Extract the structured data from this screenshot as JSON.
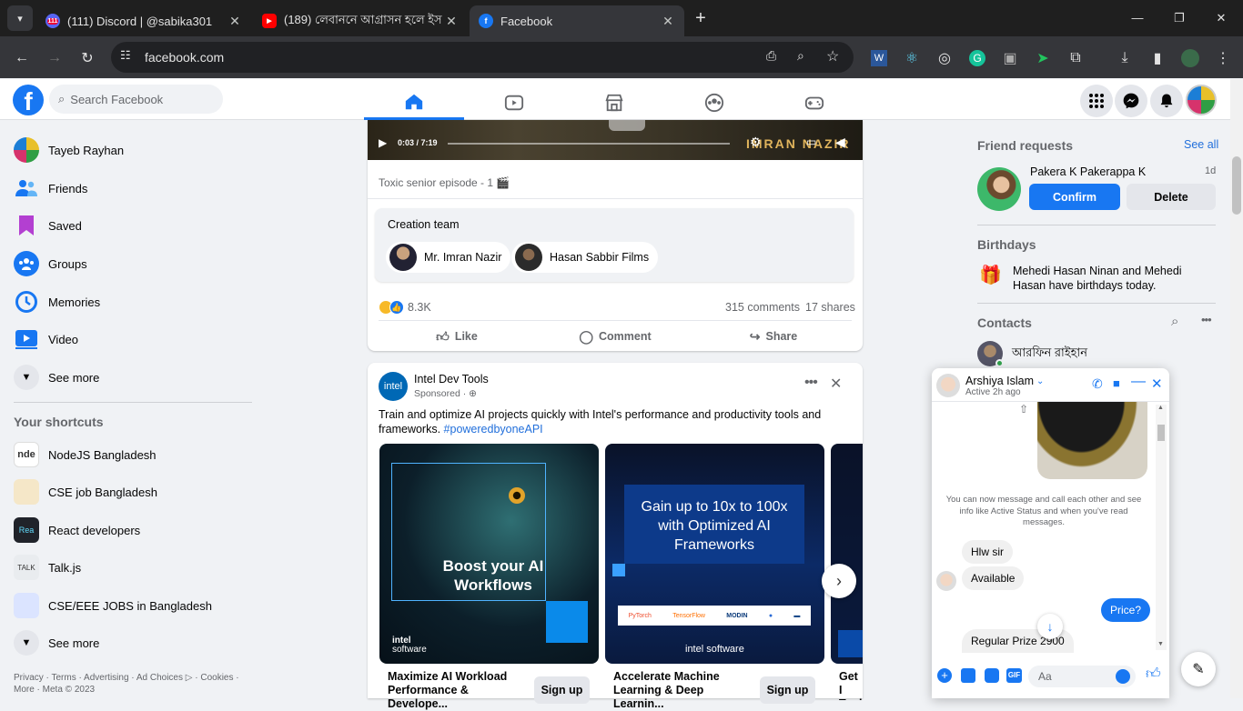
{
  "browser": {
    "tabs": [
      {
        "title": "(111) Discord | @sabika301",
        "badge": "111"
      },
      {
        "title": "(189) লেবাননে আগ্রাসন হলে ইস"
      },
      {
        "title": "Facebook"
      }
    ],
    "url": "facebook.com"
  },
  "fb": {
    "search_placeholder": "Search Facebook",
    "user_name": "Tayeb Rayhan",
    "left_menu": [
      "Friends",
      "Saved",
      "Groups",
      "Memories",
      "Video",
      "See more"
    ],
    "shortcuts_title": "Your shortcuts",
    "shortcuts": [
      "NodeJS Bangladesh",
      "CSE job Bangladesh",
      "React developers",
      "Talk.js",
      "CSE/EEE JOBS in Bangladesh",
      "See more"
    ],
    "footer": [
      "Privacy · Terms · Advertising · Ad Choices ",
      " · Cookies ·",
      "More · Meta © 2023"
    ]
  },
  "post1": {
    "video_time": "0:03 / 7:19",
    "watermark": "IMRAN NAZIR",
    "caption": "Toxic senior episode - 1 🎬",
    "creation_team_title": "Creation team",
    "creators": [
      "Mr. Imran Nazir",
      "Hasan Sabbir Films"
    ],
    "reactions_count": "8.3K",
    "comments": "315 comments",
    "shares": "17 shares",
    "actions": [
      "Like",
      "Comment",
      "Share"
    ]
  },
  "ad": {
    "advertiser": "Intel Dev Tools",
    "logo_text": "intel",
    "sponsored": "Sponsored · ",
    "text": "Train and optimize AI projects quickly with Intel's performance and productivity tools and frameworks. ",
    "hashtag": "#poweredbyoneAPI",
    "tile1_headline": "Boost your AI Workflows",
    "tile2_headline": "Gain up to 10x to 100x with Optimized AI Frameworks",
    "tile2_logos": [
      "PyTorch",
      "TensorFlow",
      "MODIN",
      "",
      ""
    ],
    "brand_line1": "intel",
    "brand_line2": "software",
    "brand_inline": "intel software",
    "tiles": [
      {
        "title": "Maximize AI Workload Performance & Develope...",
        "button": "Sign up"
      },
      {
        "title": "Accelerate Machine Learning & Deep Learnin...",
        "button": "Sign up"
      },
      {
        "title": "Get I Tools",
        "button": ""
      }
    ]
  },
  "right": {
    "friend_requests_title": "Friend requests",
    "see_all": "See all",
    "request_name": "Pakera K Pakerappa K",
    "request_time": "1d",
    "confirm": "Confirm",
    "delete": "Delete",
    "birthdays_title": "Birthdays",
    "birthday_name1": "Mehedi Hasan Ninan",
    "birthday_and": " and ",
    "birthday_name2": "Mehedi Hasan",
    "birthday_rest": " have birthdays today.",
    "contacts_title": "Contacts",
    "contact1": "আরফিন রাইহান"
  },
  "chat": {
    "name": "Arshiya Islam",
    "status": "Active 2h ago",
    "info": "You can now message and call each other and see info like Active Status and when you've read messages.",
    "messages": [
      "Hlw sir",
      "Available",
      "Price?",
      "Regular Prize  2900"
    ],
    "input_placeholder": "Aa"
  },
  "colors": {
    "fb_blue": "#1877f2",
    "chrome_dark": "#1f1f1f",
    "chrome_bar": "#35363a"
  }
}
